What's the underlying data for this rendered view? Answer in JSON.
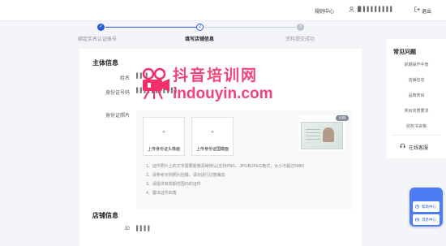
{
  "topbar": {
    "rule_link": "规则中心",
    "user_name": "█ ▌▌▌▌▌▌▌▌",
    "logout": "退出"
  },
  "steps": [
    {
      "index": "✓",
      "label": "绑定实名认证账号",
      "state": "done"
    },
    {
      "index": "2",
      "label": "填写店铺信息",
      "state": "current"
    },
    {
      "index": "3",
      "label": "资料提交成功",
      "state": "todo"
    }
  ],
  "main_section": {
    "title": "主体信息",
    "name_label": "姓名",
    "name_value": "▌▌ ▌",
    "id_number_label": "身份证号码",
    "id_number_value": "▌▌▌▌▌▌▌▌▌▌▌",
    "id_photo_label": "身份证照片",
    "upload_front": "上传身份证头像面",
    "upload_back": "上传身份证国徽面",
    "sample_badge": "示例",
    "tips": [
      "1、证件照片上的文字需要能够清晰辨认(支持PNG、JPG和JPEG格式，大小不超过5MB)",
      "2、请参考示例照片拍摄，请勿进行过度裁剪",
      "3、请提供有效期范围内的证件",
      "4、露出证件四角"
    ]
  },
  "store_section": {
    "title": "店铺信息",
    "id_label": "ID",
    "id_value": "▌▌▌▌"
  },
  "faq": {
    "title": "常见问题",
    "items": [
      "前期操作手册",
      "店铺信息",
      "品牌类目",
      "类目资质要求",
      "授权书资格"
    ],
    "customer_service": "在线客服"
  },
  "help_widget": {
    "help_center": "帮助中心",
    "message_center": "消息中心"
  },
  "watermark": {
    "cn": "抖音培训网",
    "en": "indouyin.com"
  },
  "colors": {
    "accent": "#2a5bd7",
    "help_widget": "#4b7bf5",
    "watermark": "#f22e6b"
  }
}
